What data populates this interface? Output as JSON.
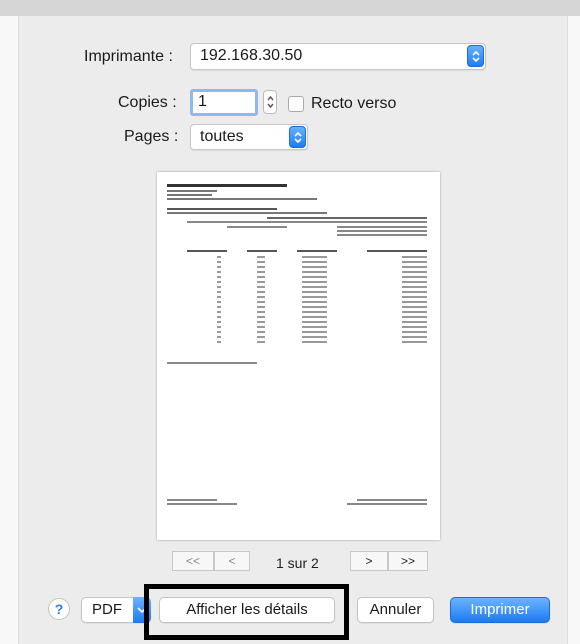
{
  "printer": {
    "label": "Imprimante :",
    "value": "192.168.30.50"
  },
  "copies": {
    "label": "Copies :",
    "value": "1",
    "duplex_label": "Recto verso",
    "duplex_checked": false
  },
  "pages": {
    "label": "Pages :",
    "value": "toutes"
  },
  "pager": {
    "first": "<<",
    "prev": "<",
    "next": ">",
    "last": ">>",
    "indicator": "1 sur 2"
  },
  "footer": {
    "help": "?",
    "pdf": "PDF",
    "details": "Afficher les détails",
    "cancel": "Annuler",
    "print": "Imprimer"
  },
  "colors": {
    "accent": "#1f7cf1",
    "highlight_border": "#000000"
  },
  "icons": [
    "updown-chevron-icon",
    "help-icon",
    "chevron-down-icon"
  ]
}
